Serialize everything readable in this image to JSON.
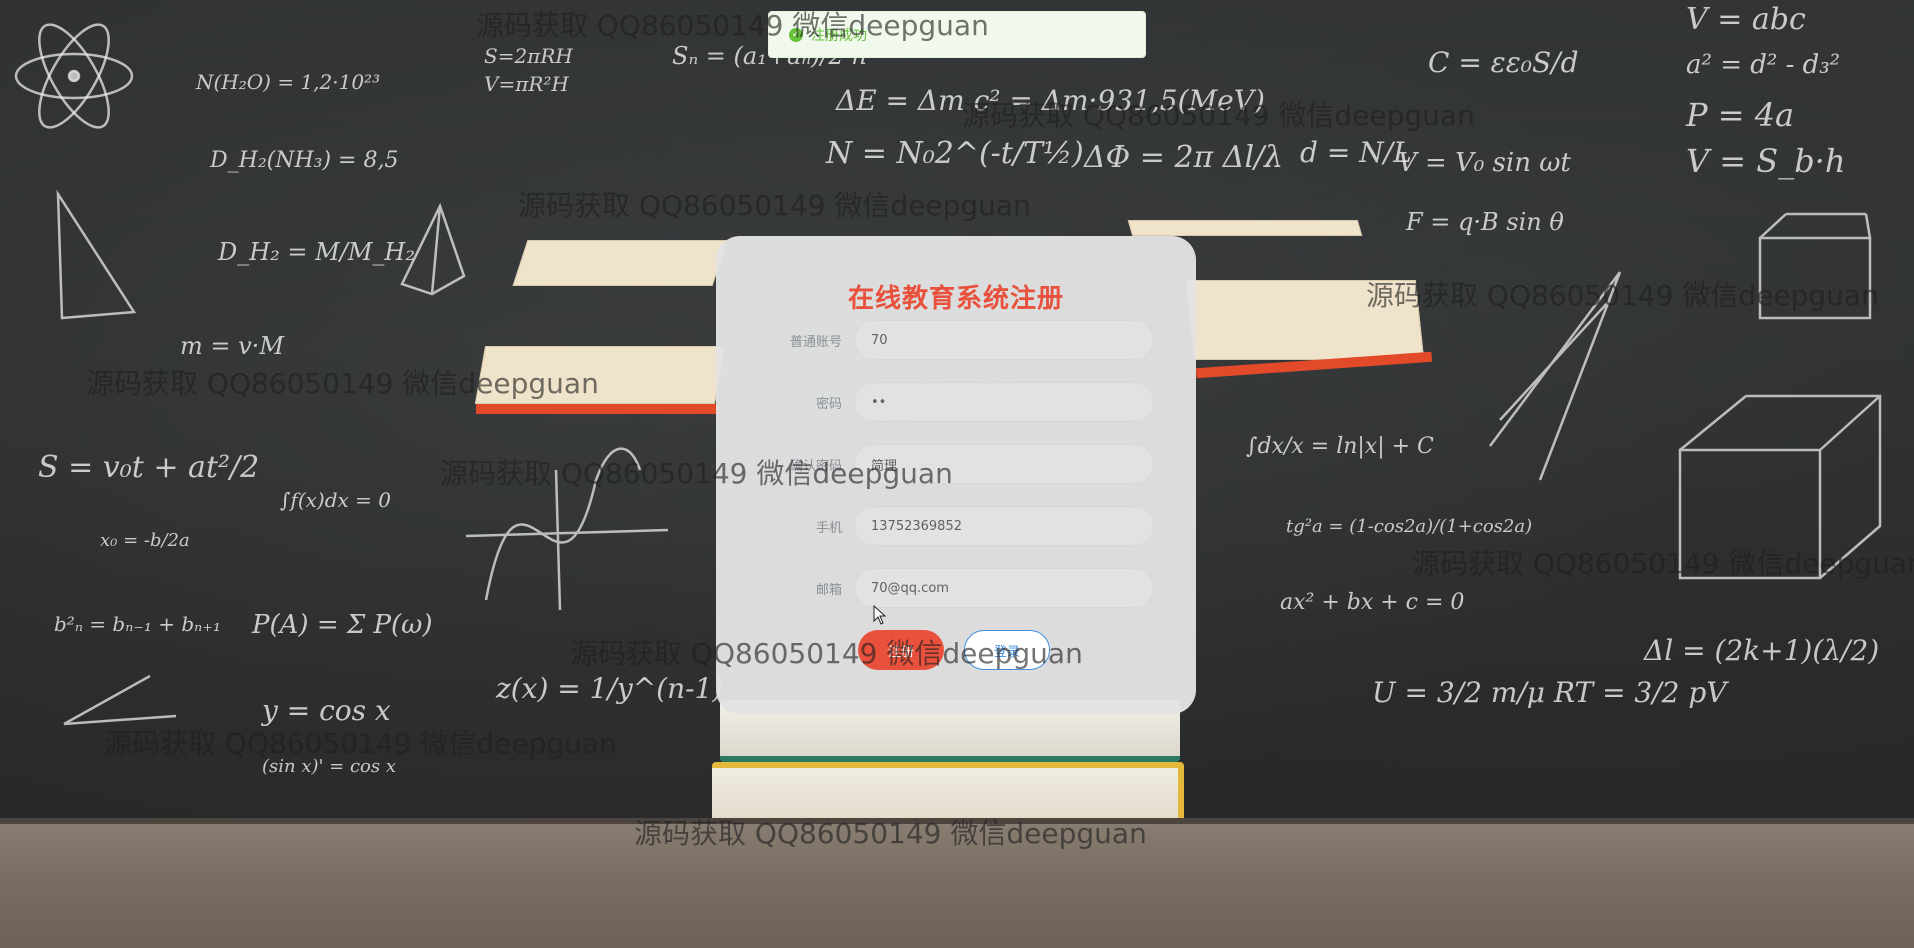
{
  "toast": {
    "text": "注册成功"
  },
  "form": {
    "title": "在线教育系统注册",
    "fields": [
      {
        "label": "普通账号",
        "value": "70"
      },
      {
        "label": "密码",
        "value": "••"
      },
      {
        "label": "确认密码",
        "value": "简理"
      },
      {
        "label": "手机",
        "value": "13752369852"
      },
      {
        "label": "邮箱",
        "value": "70@qq.com"
      }
    ],
    "register_label": "注册",
    "login_label": "登录"
  },
  "watermark": "源码获取 QQ86050149 微信deepguan",
  "chalkboard": [
    "N(H₂O) = 1,2·10²³",
    "S=2πRH",
    "V=πR²H",
    "Sₙ = (a₁+aₙ)/2 n",
    "ΔE = Δm c² = Δm·931,5(MeV)",
    "C = εε₀S/d",
    "V = abc",
    "a² = d² - d₃²",
    "P = 4a",
    "V = S_b·h",
    "D_H₂(NH₃) = 8,5",
    "N = N₀2^(-t/T½)",
    "ΔΦ = 2π Δl/λ",
    "d = N/L",
    "V = V₀ sin ωt",
    "F = q·B sin θ",
    "D_H₂ = M/M_H₂",
    "m = v·M",
    "S = v₀t + at²/2",
    "∫f(x)dx = 0",
    "∫dx/x = ln|x| + C",
    "tg²a = (1-cos2a)/(1+cos2a)",
    "x₀ = -b/2a",
    "P(A) = Σ P(ω)",
    "ax² + bx + c = 0",
    "Δl = (2k+1)(λ/2)",
    "y = cos x",
    "z(x) = 1/y^(n-1)",
    "(sin x)' = cos x",
    "U = 3/2 m/μ RT = 3/2 pV",
    "b²ₙ = bₙ₋₁ + bₙ₊₁"
  ]
}
